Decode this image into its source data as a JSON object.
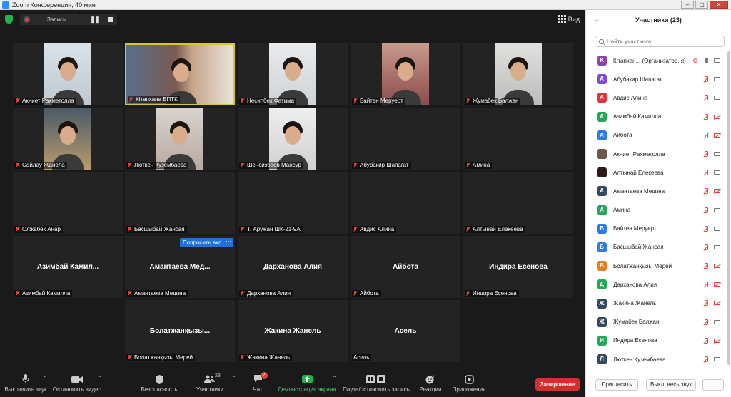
{
  "window": {
    "title": "Zoom Конференция, 40 мин"
  },
  "topbar": {
    "recording_label": "Запись...",
    "view_label": "Вид"
  },
  "tiles": [
    {
      "name": "Акниет Рахметолла",
      "big": ""
    },
    {
      "name": "Кітапхана БПТК",
      "big": ""
    },
    {
      "name": "Несипбек Фатима",
      "big": ""
    },
    {
      "name": "Байтен Меруерт",
      "big": ""
    },
    {
      "name": "Жумабек Балжан",
      "big": ""
    },
    {
      "name": "Сайлау Жанела",
      "big": ""
    },
    {
      "name": "Люткен Кузембаева",
      "big": ""
    },
    {
      "name": "Шенсизбаев Мансур",
      "big": ""
    },
    {
      "name": "Абубакир Шапагат",
      "big": ""
    },
    {
      "name": "Амина",
      "big": ""
    },
    {
      "name": "Олжабек Анар",
      "big": ""
    },
    {
      "name": "Басшыбай Жансая",
      "big": ""
    },
    {
      "name": "Т. Аружан ШК-21-9А",
      "big": ""
    },
    {
      "name": "Авдис Алина",
      "big": ""
    },
    {
      "name": "Алтынай Елекеева",
      "big": ""
    },
    {
      "name": "Азимбай Камилла",
      "big": "Азимбай  Камил..."
    },
    {
      "name": "Амантаева Медина",
      "big": "Амантаева  Мед..."
    },
    {
      "name": "Дарханова Алия",
      "big": "Дарханова Алия"
    },
    {
      "name": "Айбота",
      "big": "Айбота"
    },
    {
      "name": "Индира Есенова",
      "big": "Индира Есенова"
    },
    {
      "name": "Болатжанқызы Мерей",
      "big": "Болатжанқызы..."
    },
    {
      "name": "Жакина Жанель",
      "big": "Жакина Жанель"
    },
    {
      "name": "Асель",
      "big": "Асель"
    }
  ],
  "overlay": {
    "ask_label": "Попросить вкл",
    "more_label": "···"
  },
  "toolbar": {
    "mute": "Выключить звук",
    "video": "Остановить видео",
    "security": "Безопасность",
    "participants": "Участники",
    "participants_count": "23",
    "chat": "Чат",
    "chat_badge": "2",
    "share": "Демонстрация экрана",
    "pause_rec": "Пауза/остановить запись",
    "reactions": "Реакции",
    "apps": "Приложения",
    "end": "Завершение"
  },
  "panel": {
    "title": "Участники (23)",
    "search_placeholder": "Найти участника",
    "invite": "Пригласить",
    "mute_all": "Выкл. весь звук",
    "more": "...",
    "participants": [
      {
        "initial": "K",
        "color": "#8e44ad",
        "name": "Кітапхан...  (Организатор, я)",
        "mic_on": true,
        "cam_on": true,
        "host": true
      },
      {
        "initial": "А",
        "color": "#7b4dd6",
        "name": "Абубакир Шапагат",
        "mic_on": false,
        "cam_on": true,
        "host": false
      },
      {
        "initial": "А",
        "color": "#d9363e",
        "name": "Авдис Алина",
        "mic_on": false,
        "cam_on": true,
        "host": false
      },
      {
        "initial": "А",
        "color": "#26a65b",
        "name": "Азимбай Камилла",
        "mic_on": false,
        "cam_on": false,
        "host": false
      },
      {
        "initial": "А",
        "color": "#2d7be5",
        "name": "Айбота",
        "mic_on": false,
        "cam_on": false,
        "host": false
      },
      {
        "initial": "",
        "color": "#6b5a4a",
        "name": "Акниет Рахметолла",
        "mic_on": false,
        "cam_on": true,
        "host": false
      },
      {
        "initial": "",
        "color": "#2a1a1a",
        "name": "Алтынай Елекеева",
        "mic_on": false,
        "cam_on": true,
        "host": false
      },
      {
        "initial": "А",
        "color": "#34495e",
        "name": "Амантаева Медина",
        "mic_on": false,
        "cam_on": false,
        "host": false
      },
      {
        "initial": "А",
        "color": "#26a65b",
        "name": "Амина",
        "mic_on": false,
        "cam_on": true,
        "host": false
      },
      {
        "initial": "Б",
        "color": "#2d7be5",
        "name": "Байтен Меруерт",
        "mic_on": false,
        "cam_on": true,
        "host": false
      },
      {
        "initial": "Б",
        "color": "#2d7be5",
        "name": "Басшыбай Жансая",
        "mic_on": false,
        "cam_on": true,
        "host": false
      },
      {
        "initial": "Б",
        "color": "#e67e22",
        "name": "Болатжанқызы Мерей",
        "mic_on": false,
        "cam_on": false,
        "host": false
      },
      {
        "initial": "Д",
        "color": "#26a65b",
        "name": "Дарханова Алия",
        "mic_on": false,
        "cam_on": false,
        "host": false
      },
      {
        "initial": "Ж",
        "color": "#34495e",
        "name": "Жакина Жанель",
        "mic_on": false,
        "cam_on": false,
        "host": false
      },
      {
        "initial": "Ж",
        "color": "#34495e",
        "name": "Жумабек Балжан",
        "mic_on": false,
        "cam_on": true,
        "host": false
      },
      {
        "initial": "И",
        "color": "#26a65b",
        "name": "Индира Есенова",
        "mic_on": false,
        "cam_on": false,
        "host": false
      },
      {
        "initial": "Л",
        "color": "#34495e",
        "name": "Люткен Кузембаева",
        "mic_on": false,
        "cam_on": true,
        "host": false
      }
    ]
  }
}
